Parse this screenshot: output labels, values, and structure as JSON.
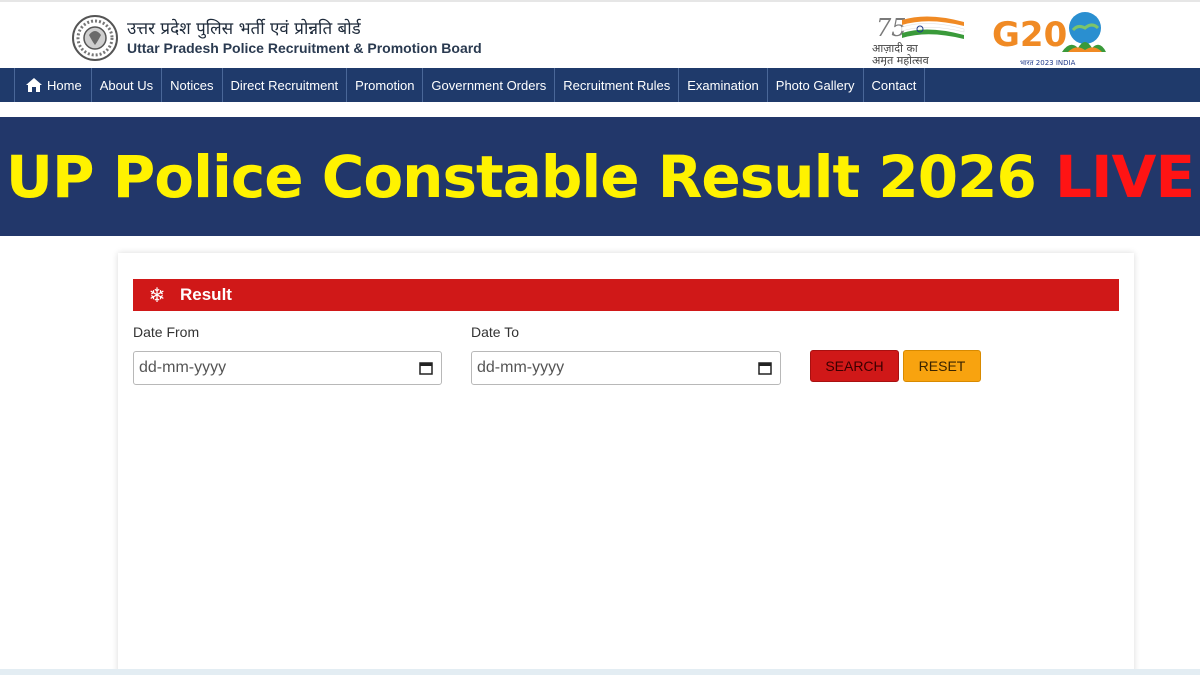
{
  "header": {
    "org_hindi": "उत्तर प्रदेश पुलिस भर्ती एवं प्रोन्नति बोर्ड",
    "org_english": "Uttar Pradesh Police Recruitment & Promotion Board",
    "azadi_logo_text": [
      "75",
      "आज़ादी का",
      "अमृत महोत्सव"
    ],
    "g20_logo_text": [
      "G20",
      "भारत 2023 INDIA"
    ]
  },
  "nav": {
    "items": [
      {
        "label": "Home"
      },
      {
        "label": "About Us"
      },
      {
        "label": "Notices"
      },
      {
        "label": "Direct Recruitment"
      },
      {
        "label": "Promotion"
      },
      {
        "label": "Government Orders"
      },
      {
        "label": "Recruitment Rules"
      },
      {
        "label": "Examination"
      },
      {
        "label": "Photo Gallery"
      },
      {
        "label": "Contact"
      }
    ]
  },
  "banner": {
    "title": "UP Police Constable Result 2026",
    "live": "LIVE"
  },
  "result_panel": {
    "title": "Result",
    "date_from_label": "Date From",
    "date_from_value": "dd-mm-yyyy",
    "date_to_label": "Date To",
    "date_to_value": "dd-mm-yyyy",
    "search_label": "SEARCH",
    "reset_label": "RESET"
  },
  "colors": {
    "nav_bg": "#1f3a6b",
    "banner_bg": "#22376a",
    "banner_text": "#fff200",
    "live_text": "#ff1414",
    "panel_header": "#d01818",
    "reset_button": "#f8a30f"
  },
  "icons": {
    "emblem": "police-emblem-icon",
    "home": "home-icon",
    "panel": "snowflake-icon",
    "calendar": "calendar-icon"
  }
}
